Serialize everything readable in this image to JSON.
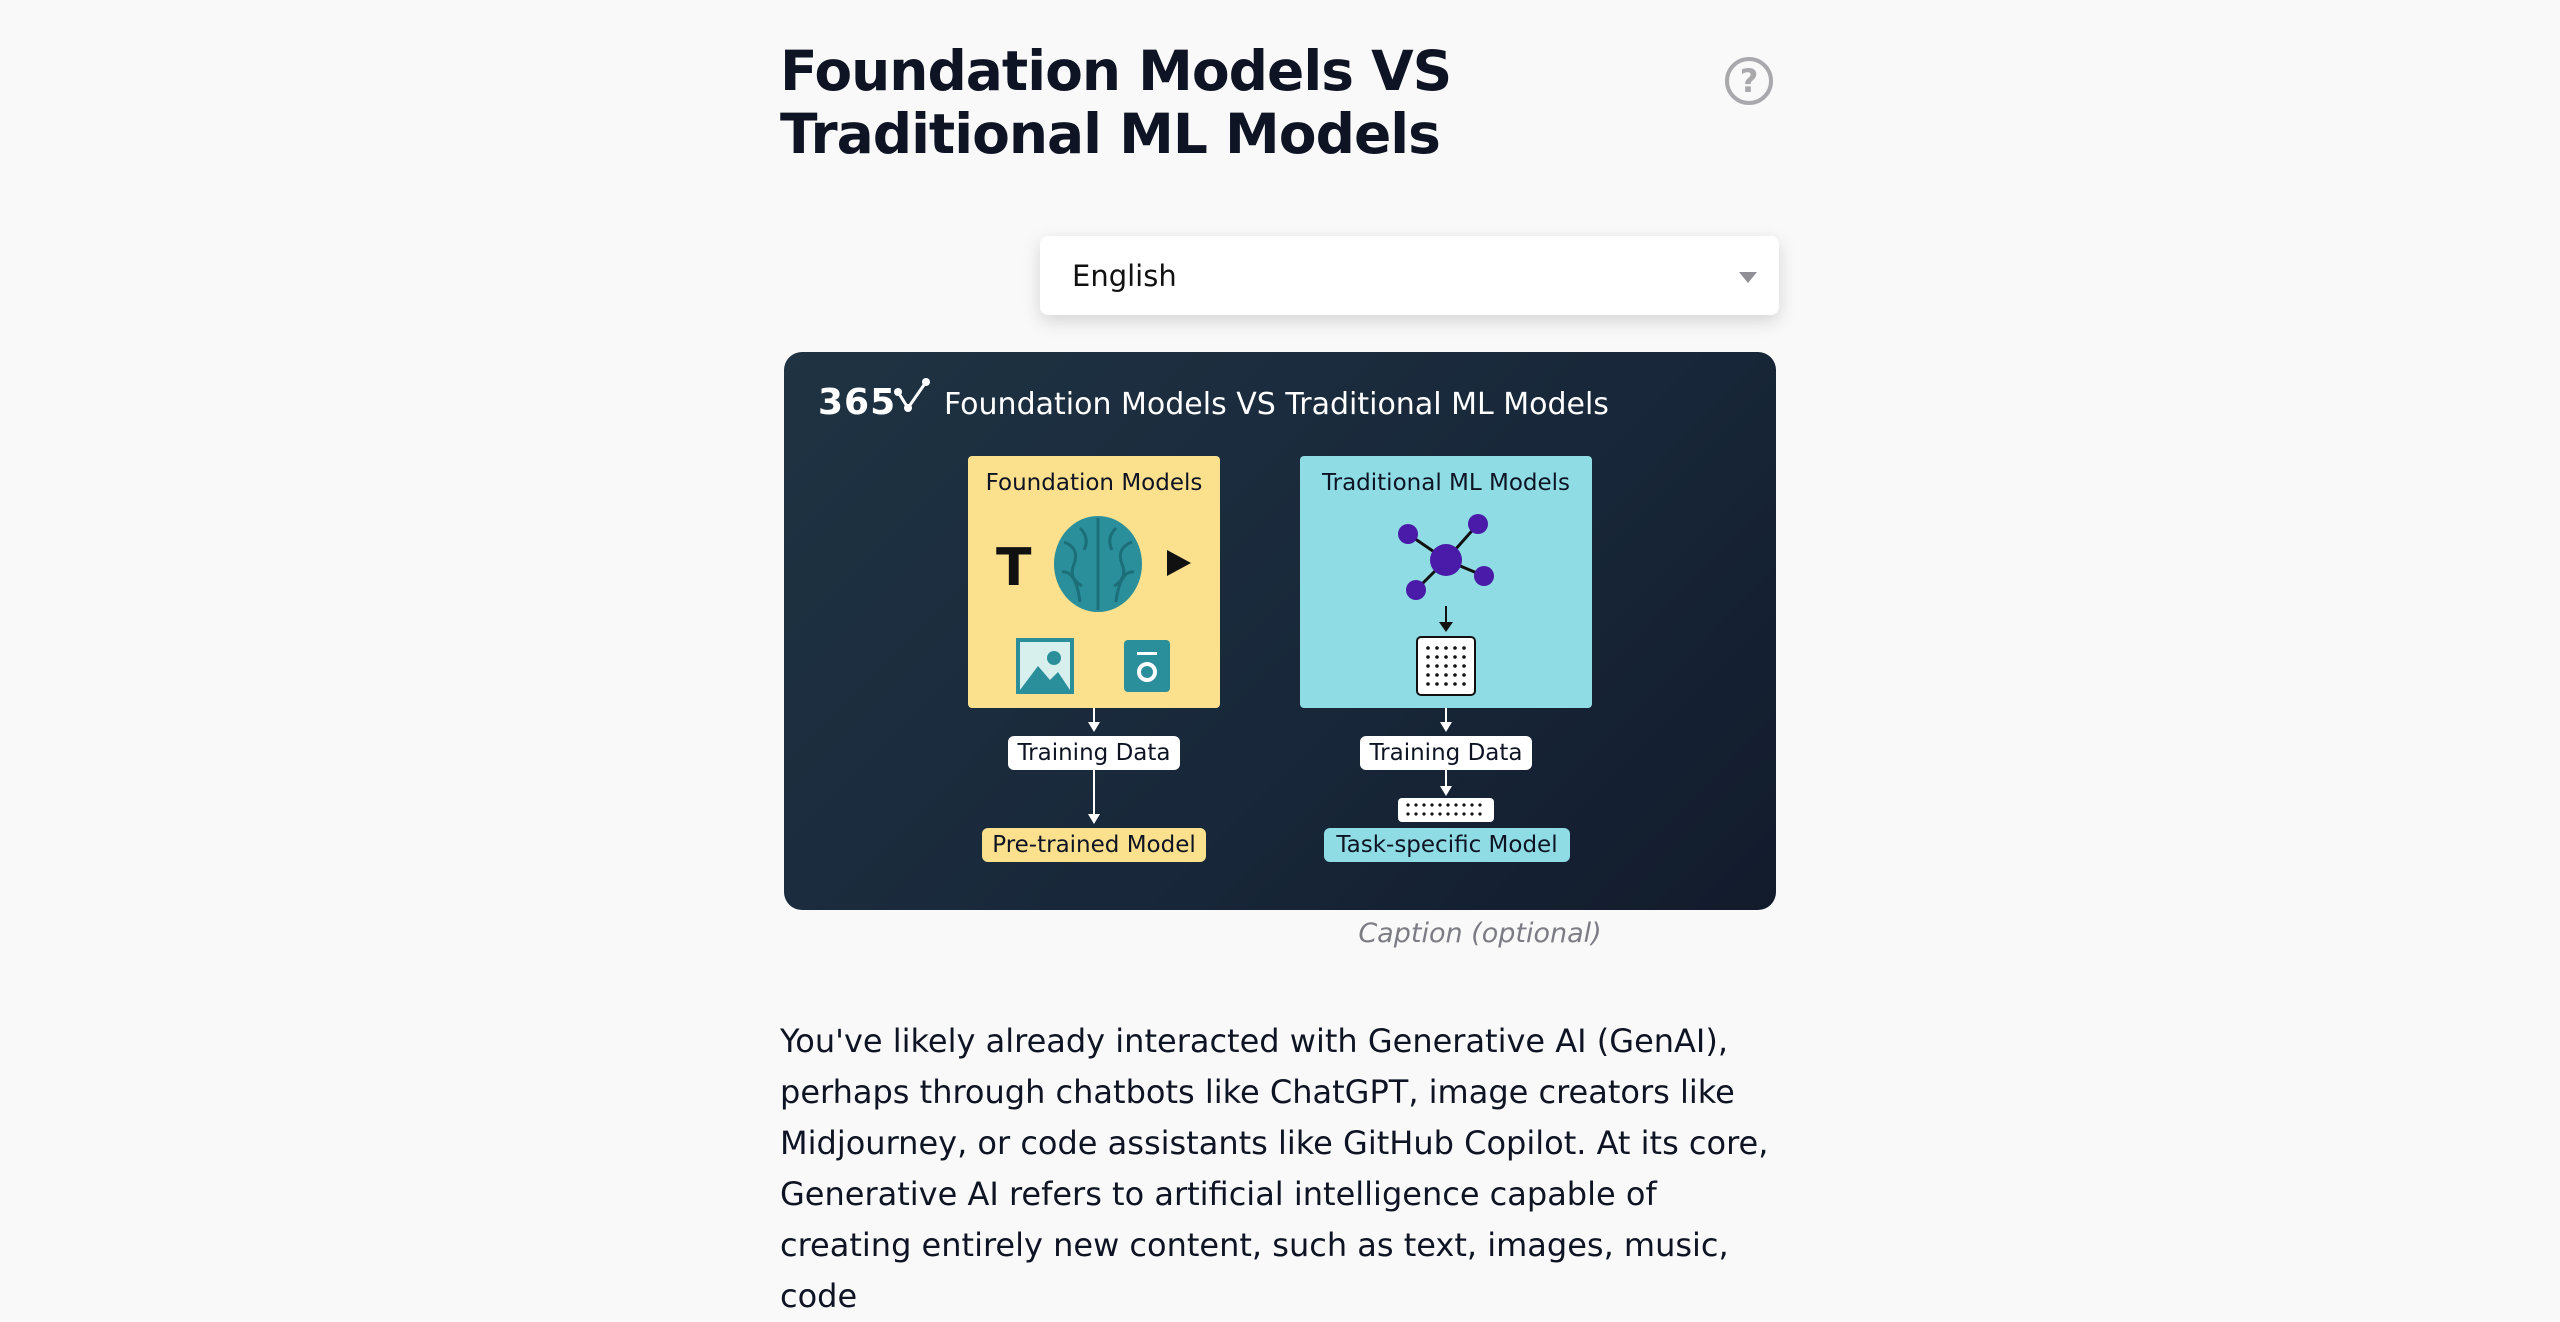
{
  "article": {
    "title": "Foundation Models VS Traditional ML Models",
    "help_label": "?",
    "language_select": {
      "selected": "English"
    },
    "figure": {
      "logo": "365",
      "title": "Foundation Models VS Traditional ML Models",
      "foundation": {
        "label": "Foundation Models",
        "text_glyph": "T",
        "training_label": "Training Data",
        "output_label": "Pre-trained Model"
      },
      "traditional": {
        "label": "Traditional ML Models",
        "training_label": "Training Data",
        "output_label": "Task-specific Model"
      }
    },
    "caption": "Caption (optional)",
    "body": "You've likely already interacted with Generative AI (GenAI), perhaps through chatbots like ChatGPT, image creators like Midjourney, or code assistants like GitHub Copilot. At its core, Generative AI refers to artificial intelligence capable of creating entirely new content, such as text, images, music, code"
  },
  "colors": {
    "background": "#f9f9f9",
    "text": "#0e1424",
    "foundation_card": "#fbe08d",
    "traditional_card": "#8fdce5",
    "figure_bg": "#18283a",
    "brain": "#2a8f9a",
    "network_node": "#4a1aa8"
  },
  "icons": [
    "help-icon",
    "chevron-down-icon",
    "brain-icon",
    "play-icon",
    "image-icon",
    "audio-icon",
    "network-icon",
    "grid-icon",
    "arrow-down-icon"
  ]
}
